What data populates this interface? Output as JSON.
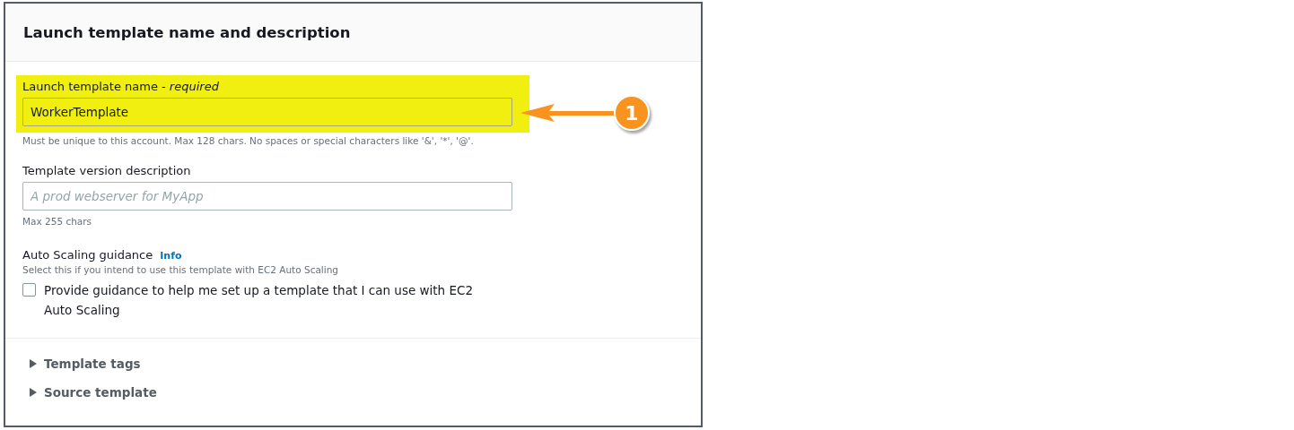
{
  "panel": {
    "title": "Launch template name and description"
  },
  "name_field": {
    "label": "Launch template name - *required*",
    "value": "WorkerTemplate",
    "hint": "Must be unique to this account. Max 128 chars. No spaces or special characters like '&', '*', '@'.",
    "highlighted": true
  },
  "description_field": {
    "label": "Template version description",
    "placeholder": "A prod webserver for MyApp",
    "hint": "Max 255 chars"
  },
  "auto_scaling": {
    "label": "Auto Scaling guidance",
    "info_link": "Info",
    "hint": "Select this if you intend to use this template with EC2 Auto Scaling",
    "checkbox_label": "Provide guidance to help me set up a template that I can use with EC2 Auto Scaling",
    "checked": false
  },
  "sections": [
    {
      "label": "Template tags",
      "expanded": false
    },
    {
      "label": "Source template",
      "expanded": false
    }
  ],
  "callout": {
    "number": "1"
  }
}
